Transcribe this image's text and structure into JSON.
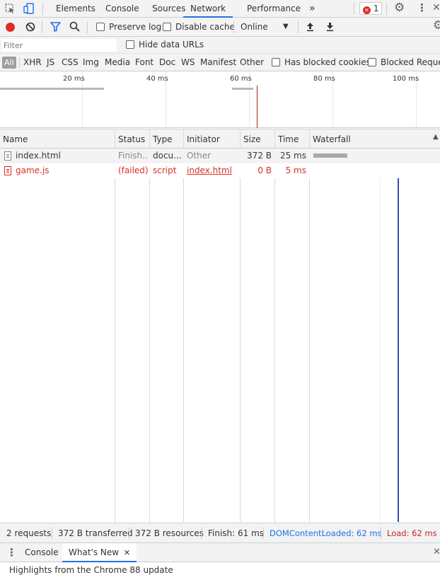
{
  "tabs": {
    "elements": "Elements",
    "console": "Console",
    "sources": "Sources",
    "network": "Network",
    "performance": "Performance",
    "more": "»",
    "error_count": "1"
  },
  "toolbar": {
    "preserve_log": "Preserve log",
    "disable_cache": "Disable cache",
    "throttle": "Online"
  },
  "filter": {
    "placeholder": "Filter",
    "hide_data_urls": "Hide data URLs"
  },
  "type_filters": {
    "all": "All",
    "items": [
      "XHR",
      "JS",
      "CSS",
      "Img",
      "Media",
      "Font",
      "Doc",
      "WS",
      "Manifest",
      "Other"
    ],
    "has_blocked_cookies": "Has blocked cookies",
    "blocked_requests": "Blocked Reques"
  },
  "overview": {
    "ticks": [
      "20 ms",
      "40 ms",
      "60 ms",
      "80 ms",
      "100 ms"
    ]
  },
  "columns": {
    "name": "Name",
    "status": "Status",
    "type": "Type",
    "initiator": "Initiator",
    "size": "Size",
    "time": "Time",
    "waterfall": "Waterfall"
  },
  "requests": [
    {
      "name": "index.html",
      "status": "Finish...",
      "type": "docu...",
      "initiator": "Other",
      "size": "372 B",
      "time": "25 ms"
    },
    {
      "name": "game.js",
      "status": "(failed)",
      "type": "script",
      "initiator": "index.html",
      "size": "0 B",
      "time": "5 ms"
    }
  ],
  "status": {
    "requests": "2 requests",
    "transferred": "372 B transferred",
    "resources": "372 B resources",
    "finish": "Finish: 61 ms",
    "dom_loaded": "DOMContentLoaded: 62 ms",
    "load": "Load: 62 ms"
  },
  "drawer": {
    "console": "Console",
    "whats_new": "What's New",
    "content": "Highlights from the Chrome 88 update"
  },
  "colors": {
    "accent": "#1a73e8",
    "error": "#d93025",
    "dom_loaded": "#1a73e8",
    "load": "#c5221f"
  }
}
